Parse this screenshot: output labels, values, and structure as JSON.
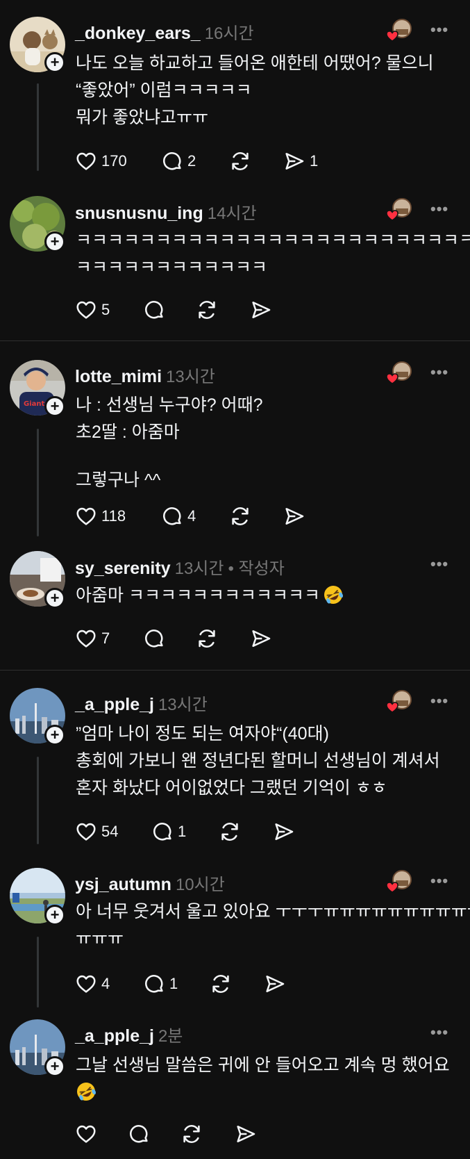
{
  "icons": {
    "more": "more-dots-icon",
    "like": "heart-icon",
    "reply": "reply-bubble-icon",
    "repost": "repost-icon",
    "share": "share-icon",
    "follow": "plus-icon",
    "liked_by_author": "liked-by-author-icon"
  },
  "colors": {
    "background": "#101010",
    "text": "#f3f5f7",
    "secondary": "#777777",
    "heart": "#ff3040"
  },
  "posts": [
    {
      "username": "_donkey_ears_",
      "time": "16시간",
      "lines": [
        "나도 오늘 하교하고 들어온 애한테 어땠어? 물으니",
        "“좋았어” 이럼ㅋㅋㅋㅋㅋ",
        "뭐가 좋았냐고ㅠㅠ"
      ],
      "likes": "170",
      "replies": "2",
      "shares": "1"
    },
    {
      "username": "snusnusnu_ing",
      "time": "14시간",
      "lines": [
        "ㅋㅋㅋㅋㅋㅋㅋㅋㅋㅋㅋㅋㅋㅋㅋㅋㅋㅋㅋㅋㅋㅋㅋㅋㅋ",
        "ㅋㅋㅋㅋㅋㅋㅋㅋㅋㅋㅋㅋ"
      ],
      "likes": "5"
    },
    {
      "username": "lotte_mimi",
      "time": "13시간",
      "lines": [
        "나 : 선생님 누구야? 어때?",
        "초2딸 : 아줌마",
        "",
        "그렇구나 ^^"
      ],
      "likes": "118",
      "replies": "4"
    },
    {
      "username": "sy_serenity",
      "time": "13시간",
      "author_tag": "• 작성자",
      "lines": [
        "아줌마 ㅋㅋㅋㅋㅋㅋㅋㅋㅋㅋㅋㅋ"
      ],
      "likes": "7"
    },
    {
      "username": "_a_pple_j",
      "time": "13시간",
      "lines": [
        "”엄마 나이 정도 되는 여자야“(40대)",
        "총회에 가보니 왠 정년다된 할머니 선생님이 계셔서",
        "혼자 화났다 어이없었다 그랬던 기억이 ㅎㅎ"
      ],
      "likes": "54",
      "replies": "1"
    },
    {
      "username": "ysj_autumn",
      "time": "10시간",
      "lines": [
        "아 너무 웃겨서 울고 있아요 ㅜㅜㅜㅠㅠㅠㅠㅠㅠㅠㅠㅠㅠ",
        "ㅠㅠㅠ"
      ],
      "likes": "4",
      "replies": "1"
    },
    {
      "username": "_a_pple_j",
      "time": "2분",
      "lines": [
        "그날 선생님 말씀은 귀에 안 들어오고 계속 멍 했어요"
      ]
    }
  ]
}
